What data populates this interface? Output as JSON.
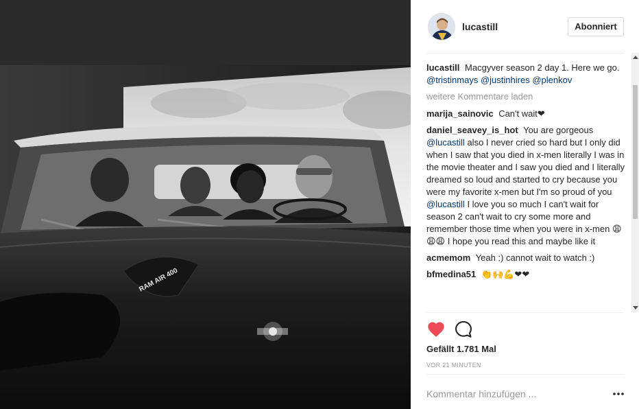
{
  "post": {
    "username": "lucastill",
    "follow_label": "Abonniert",
    "caption": {
      "user": "lucastill",
      "text": "Macgyver season 2 day 1. Here we go.",
      "mentions": [
        "@tristinmays",
        "@justinhires",
        "@plenkov"
      ]
    },
    "load_more_label": "weitere Kommentare laden",
    "comments": [
      {
        "user": "marija_sainovic",
        "text": "Can't wait❤"
      },
      {
        "user": "daniel_seavey_is_hot",
        "part1": "You are gorgeous",
        "mention1": "@lucastill",
        "part2": "also I never cried so hard but I only did when I saw that you died in x-men literally I was in the movie theater and I saw you died and I literally dreamed so loud and started to cry because you were my favorite x-men but I'm so proud of you",
        "mention2": "@lucastill",
        "part3": "I love you so much I can't wait for season 2 can't wait to cry some more and remember those time when you were in x-men 😩😩😩 I hope you read this and maybe like it"
      },
      {
        "user": "acmemom",
        "text": "Yeah :) cannot wait to watch :)"
      },
      {
        "user": "bfmedina51",
        "text": "👏🙌💪❤❤"
      }
    ],
    "likes_text": "Gefällt 1.781 Mal",
    "timestamp": "VOR 21 MINUTEN",
    "comment_placeholder": "Kommentar hinzufügen ...",
    "photo_text": "RAM AIR 400",
    "icons": {
      "like": "heart-icon",
      "comment": "speech-bubble-icon",
      "options": "ellipsis-icon"
    },
    "colors": {
      "like": "#ed4956",
      "mention": "#003569",
      "muted": "#999999"
    }
  }
}
